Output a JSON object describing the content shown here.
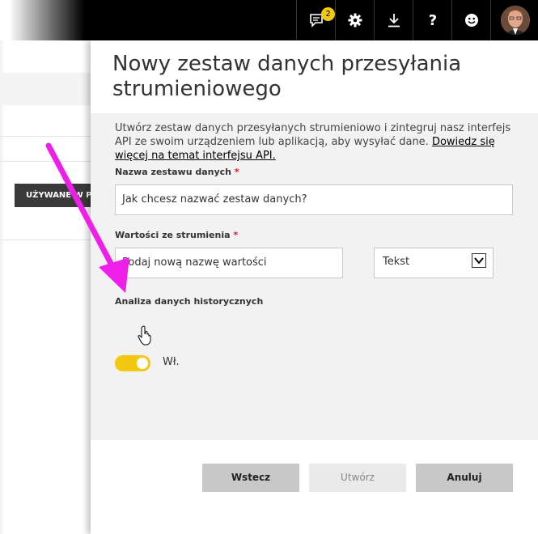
{
  "topbar": {
    "notification_count": "2",
    "icons": [
      "notifications-icon",
      "gear-icon",
      "download-icon",
      "help-icon",
      "smiley-icon"
    ]
  },
  "background": {
    "column_header": "UŻYWANE W P"
  },
  "panel": {
    "title": "Nowy zestaw danych przesyłania strumieniowego",
    "description": "Utwórz zestaw danych przesyłanych strumieniowo i zintegruj nasz interfejs API ze swoim urządzeniem lub aplikacją, aby wysyłać dane. ",
    "learn_more": "Dowiedz się więcej na temat interfejsu API.",
    "dataset_name_label": "Nazwa zestawu danych",
    "dataset_name_placeholder": "Jak chcesz nazwać zestaw danych?",
    "stream_values_label": "Wartości ze strumienia",
    "value_name_placeholder": "Podaj nową nazwę wartości",
    "value_type_selected": "Tekst",
    "history_label": "Analiza danych historycznych",
    "history_toggle_state": "Wł.",
    "required_marker": "*"
  },
  "buttons": {
    "back": "Wstecz",
    "create": "Utwórz",
    "cancel": "Anuluj"
  },
  "colors": {
    "accent": "#f2c811",
    "arrow": "#ee1fe8",
    "required": "#e81123"
  }
}
